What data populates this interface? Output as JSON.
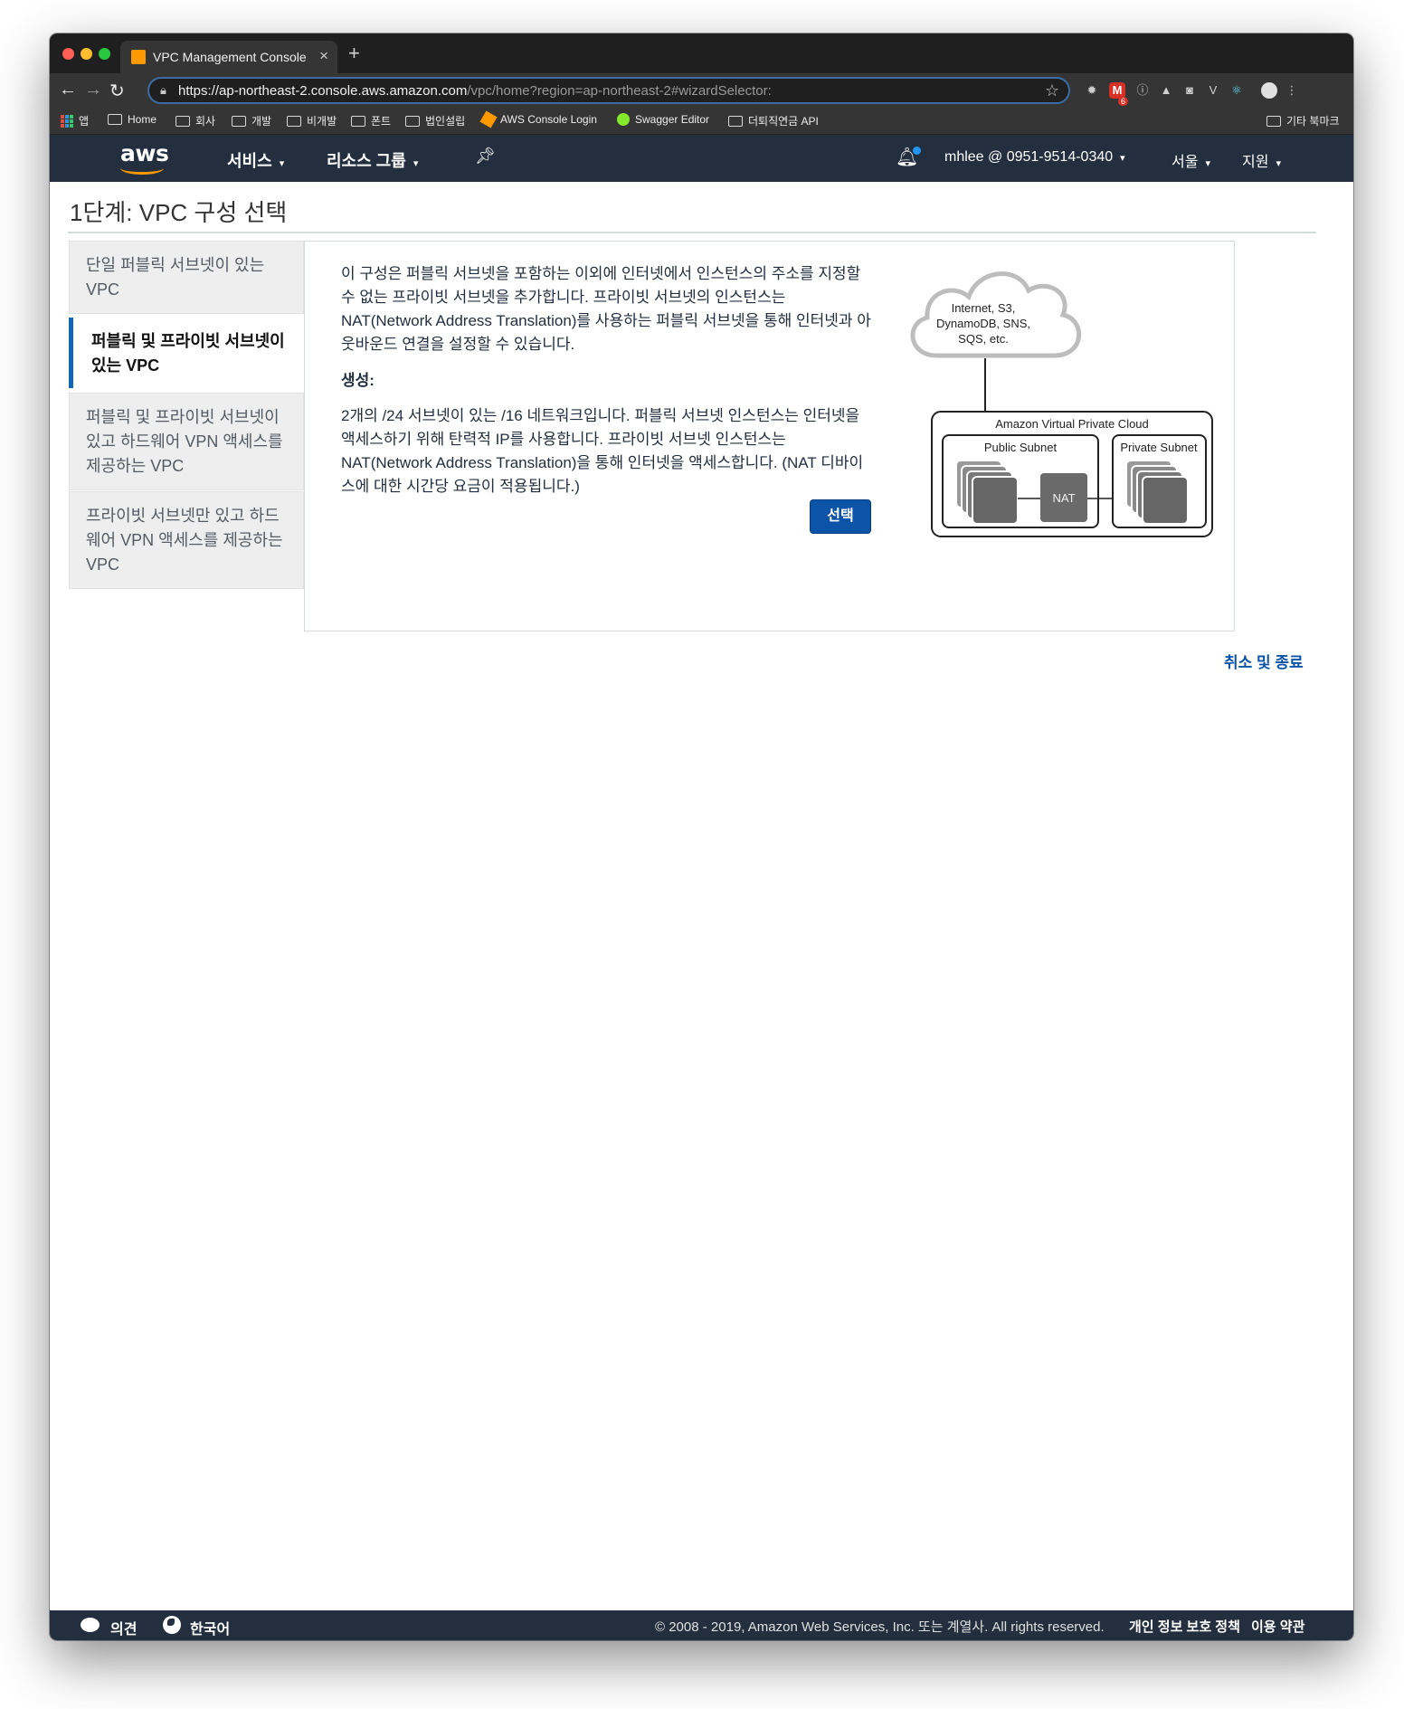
{
  "browser": {
    "tab_title": "VPC Management Console",
    "url_host": "https://ap-northeast-2.console.aws.amazon.com",
    "url_path": "/vpc/home?region=ap-northeast-2#wizardSelector:",
    "extension_badge": "6",
    "bookmarks": [
      "앱",
      "Home",
      "회사",
      "개발",
      "비개발",
      "폰트",
      "법인설립",
      "AWS Console Login",
      "Swagger Editor",
      "더퇴직연금 API"
    ],
    "other_bookmarks": "기타 북마크"
  },
  "header": {
    "logo": "aws",
    "services": "서비스",
    "resource_groups": "리소스 그룹",
    "account": "mhlee @ 0951-9514-0340",
    "region": "서울",
    "support": "지원"
  },
  "page": {
    "title": "1단계: VPC 구성 선택",
    "options": [
      {
        "label": "단일 퍼블릭 서브넷이 있는 VPC"
      },
      {
        "label": "퍼블릭 및 프라이빗 서브넷이 있는 VPC"
      },
      {
        "label": "퍼블릭 및 프라이빗 서브넷이 있고 하드웨어 VPN 액세스를 제공하는 VPC"
      },
      {
        "label": "프라이빗 서브넷만 있고 하드웨어 VPN 액세스를 제공하는 VPC"
      }
    ],
    "description": "이 구성은 퍼블릭 서브넷을 포함하는 이외에 인터넷에서 인스턴스의 주소를 지정할 수 없는 프라이빗 서브넷을 추가합니다. 프라이빗 서브넷의 인스턴스는 NAT(Network Address Translation)를 사용하는 퍼블릭 서브넷을 통해 인터넷과 아웃바운드 연결을 설정할 수 있습니다.",
    "creates_label": "생성:",
    "creates_text": "2개의 /24 서브넷이 있는 /16 네트워크입니다. 퍼블릭 서브넷 인스턴스는 인터넷을 액세스하기 위해 탄력적 IP를 사용합니다. 프라이빗 서브넷 인스턴스는 NAT(Network Address Translation)을 통해 인터넷을 액세스합니다. (NAT 디바이스에 대한 시간당 요금이 적용됩니다.)",
    "select_button": "선택",
    "cancel_link": "취소 및 종료"
  },
  "diagram": {
    "cloud_line1": "Internet, S3,",
    "cloud_line2": "DynamoDB, SNS,",
    "cloud_line3": "SQS, etc.",
    "vpc_label": "Amazon Virtual Private Cloud",
    "public_subnet": "Public Subnet",
    "private_subnet": "Private Subnet",
    "nat": "NAT"
  },
  "footer": {
    "feedback": "의견",
    "language": "한국어",
    "copyright": "© 2008 - 2019, Amazon Web Services, Inc. 또는 계열사. All rights reserved.",
    "privacy": "개인 정보 보호 정책",
    "terms": "이용 약관"
  }
}
